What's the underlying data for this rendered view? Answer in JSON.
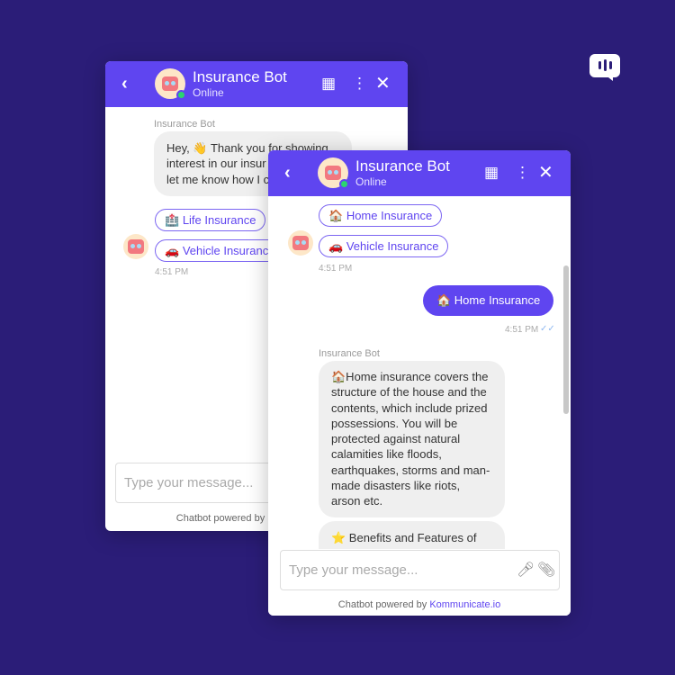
{
  "brand": {
    "logo_icon": "chat-bars-icon"
  },
  "back_window": {
    "header": {
      "title": "Insurance Bot",
      "status": "Online"
    },
    "sender": "Insurance Bot",
    "message_lines": [
      "Hey, 👋 Thank you for showing",
      "interest in our insur",
      "let me know how I c"
    ],
    "options": [
      {
        "emoji": "🏥",
        "label": "Life Insurance"
      },
      {
        "emoji": "🚗",
        "label": "Vehicle Insurance"
      }
    ],
    "time": "4:51 PM",
    "input_placeholder": "Type your message...",
    "footer": "Chatbot powered by"
  },
  "front_window": {
    "header": {
      "title": "Insurance Bot",
      "status": "Online"
    },
    "options": [
      {
        "emoji": "🏠",
        "label": "Home Insurance"
      },
      {
        "emoji": "🚗",
        "label": "Vehicle Insurance"
      }
    ],
    "options_time": "4:51 PM",
    "user_message": "🏠 Home Insurance",
    "user_time": "4:51 PM",
    "read_receipt": "✓✓",
    "sender": "Insurance Bot",
    "bot_message": "🏠Home insurance covers the structure of the house and the contents, which include prized possessions. You will be protected against natural calamities like floods, earthquakes, storms and man-made disasters like riots, arson etc.",
    "bot_message_2": "⭐ Benefits and Features of",
    "input_placeholder": "Type your message...",
    "footer_prefix": "Chatbot powered by ",
    "footer_link": "Kommunicate.io"
  },
  "colors": {
    "background": "#2b1d78",
    "accent": "#5f45f0",
    "online": "#2bd46f"
  }
}
